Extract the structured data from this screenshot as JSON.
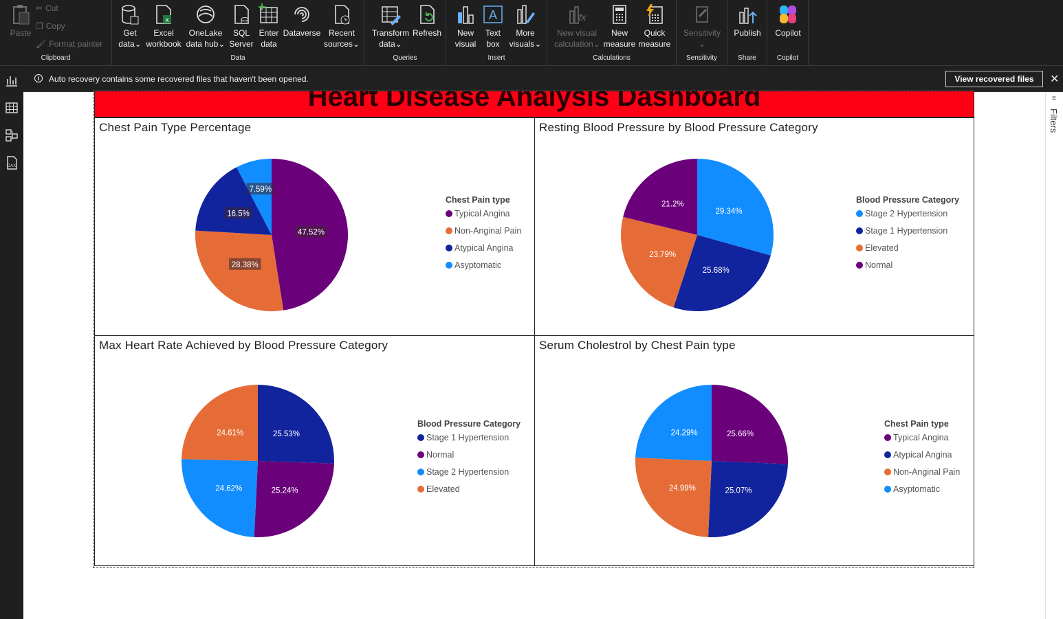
{
  "ribbon": {
    "clipboard": {
      "paste": "Paste",
      "cut": "Cut",
      "copy": "Copy",
      "format_painter": "Format painter",
      "label": "Clipboard"
    },
    "data": {
      "get_data": [
        "Get",
        "data"
      ],
      "excel": [
        "Excel",
        "workbook"
      ],
      "onelake": [
        "OneLake",
        "data hub"
      ],
      "sql": [
        "SQL",
        "Server"
      ],
      "enter": [
        "Enter",
        "data"
      ],
      "dataverse": "Dataverse",
      "recent": [
        "Recent",
        "sources"
      ],
      "label": "Data"
    },
    "queries": {
      "transform": [
        "Transform",
        "data"
      ],
      "refresh": "Refresh",
      "label": "Queries"
    },
    "insert": {
      "new_visual": [
        "New",
        "visual"
      ],
      "text_box": [
        "Text",
        "box"
      ],
      "more_visuals": [
        "More",
        "visuals"
      ],
      "label": "Insert"
    },
    "calculations": {
      "new_visual_calc": [
        "New visual",
        "calculation"
      ],
      "new_measure": [
        "New",
        "measure"
      ],
      "quick_measure": [
        "Quick",
        "measure"
      ],
      "label": "Calculations"
    },
    "sensitivity": {
      "button": "Sensitivity",
      "label": "Sensitivity"
    },
    "share": {
      "publish": "Publish",
      "label": "Share"
    },
    "copilot": {
      "button": "Copilot",
      "label": "Copilot"
    }
  },
  "infobar": {
    "message": "Auto recovery contains some recovered files that haven't been opened.",
    "button": "View recovered files"
  },
  "right_pane": {
    "filters": "Filters"
  },
  "dashboard": {
    "title": "Heart Disease Analysis Dashboard"
  },
  "colors": {
    "purple": "#6b007b",
    "orange": "#e66c37",
    "navy": "#12239e",
    "blue": "#118dff",
    "banner": "#fe0015"
  },
  "chart_data": [
    {
      "type": "pie",
      "title": "Chest Pain Type Percentage",
      "legend_title": "Chest Pain type",
      "slices": [
        {
          "name": "Typical Angina",
          "value": 47.52,
          "label": "47.52%",
          "color": "#6b007b"
        },
        {
          "name": "Non-Anginal Pain",
          "value": 28.38,
          "label": "28.38%",
          "color": "#e66c37"
        },
        {
          "name": "Atypical Angina",
          "value": 16.5,
          "label": "16.5%",
          "color": "#12239e"
        },
        {
          "name": "Asyptomatic",
          "value": 7.59,
          "label": "7.59%",
          "color": "#118dff"
        }
      ]
    },
    {
      "type": "pie",
      "title": "Resting Blood Pressure by Blood Pressure Category",
      "legend_title": "Blood Pressure Category",
      "slices": [
        {
          "name": "Stage 2 Hypertension",
          "value": 29.34,
          "label": "29.34%",
          "color": "#118dff"
        },
        {
          "name": "Stage 1 Hypertension",
          "value": 25.68,
          "label": "25.68%",
          "color": "#12239e"
        },
        {
          "name": "Elevated",
          "value": 23.79,
          "label": "23.79%",
          "color": "#e66c37"
        },
        {
          "name": "Normal",
          "value": 21.2,
          "label": "21.2%",
          "color": "#6b007b"
        }
      ]
    },
    {
      "type": "pie",
      "title": "Max Heart Rate Achieved by Blood Pressure Category",
      "legend_title": "Blood Pressure Category",
      "slices": [
        {
          "name": "Stage 1 Hypertension",
          "value": 25.53,
          "label": "25.53%",
          "color": "#12239e"
        },
        {
          "name": "Normal",
          "value": 25.24,
          "label": "25.24%",
          "color": "#6b007b"
        },
        {
          "name": "Stage 2 Hypertension",
          "value": 24.62,
          "label": "24.62%",
          "color": "#118dff"
        },
        {
          "name": "Elevated",
          "value": 24.61,
          "label": "24.61%",
          "color": "#e66c37"
        }
      ]
    },
    {
      "type": "pie",
      "title": "Serum Cholestrol by Chest Pain type",
      "legend_title": "Chest Pain type",
      "slices": [
        {
          "name": "Typical Angina",
          "value": 25.66,
          "label": "25.66%",
          "color": "#6b007b"
        },
        {
          "name": "Atypical Angina",
          "value": 25.07,
          "label": "25.07%",
          "color": "#12239e"
        },
        {
          "name": "Non-Anginal Pain",
          "value": 24.99,
          "label": "24.99%",
          "color": "#e66c37"
        },
        {
          "name": "Asyptomatic",
          "value": 24.29,
          "label": "24.29%",
          "color": "#118dff"
        }
      ]
    }
  ]
}
